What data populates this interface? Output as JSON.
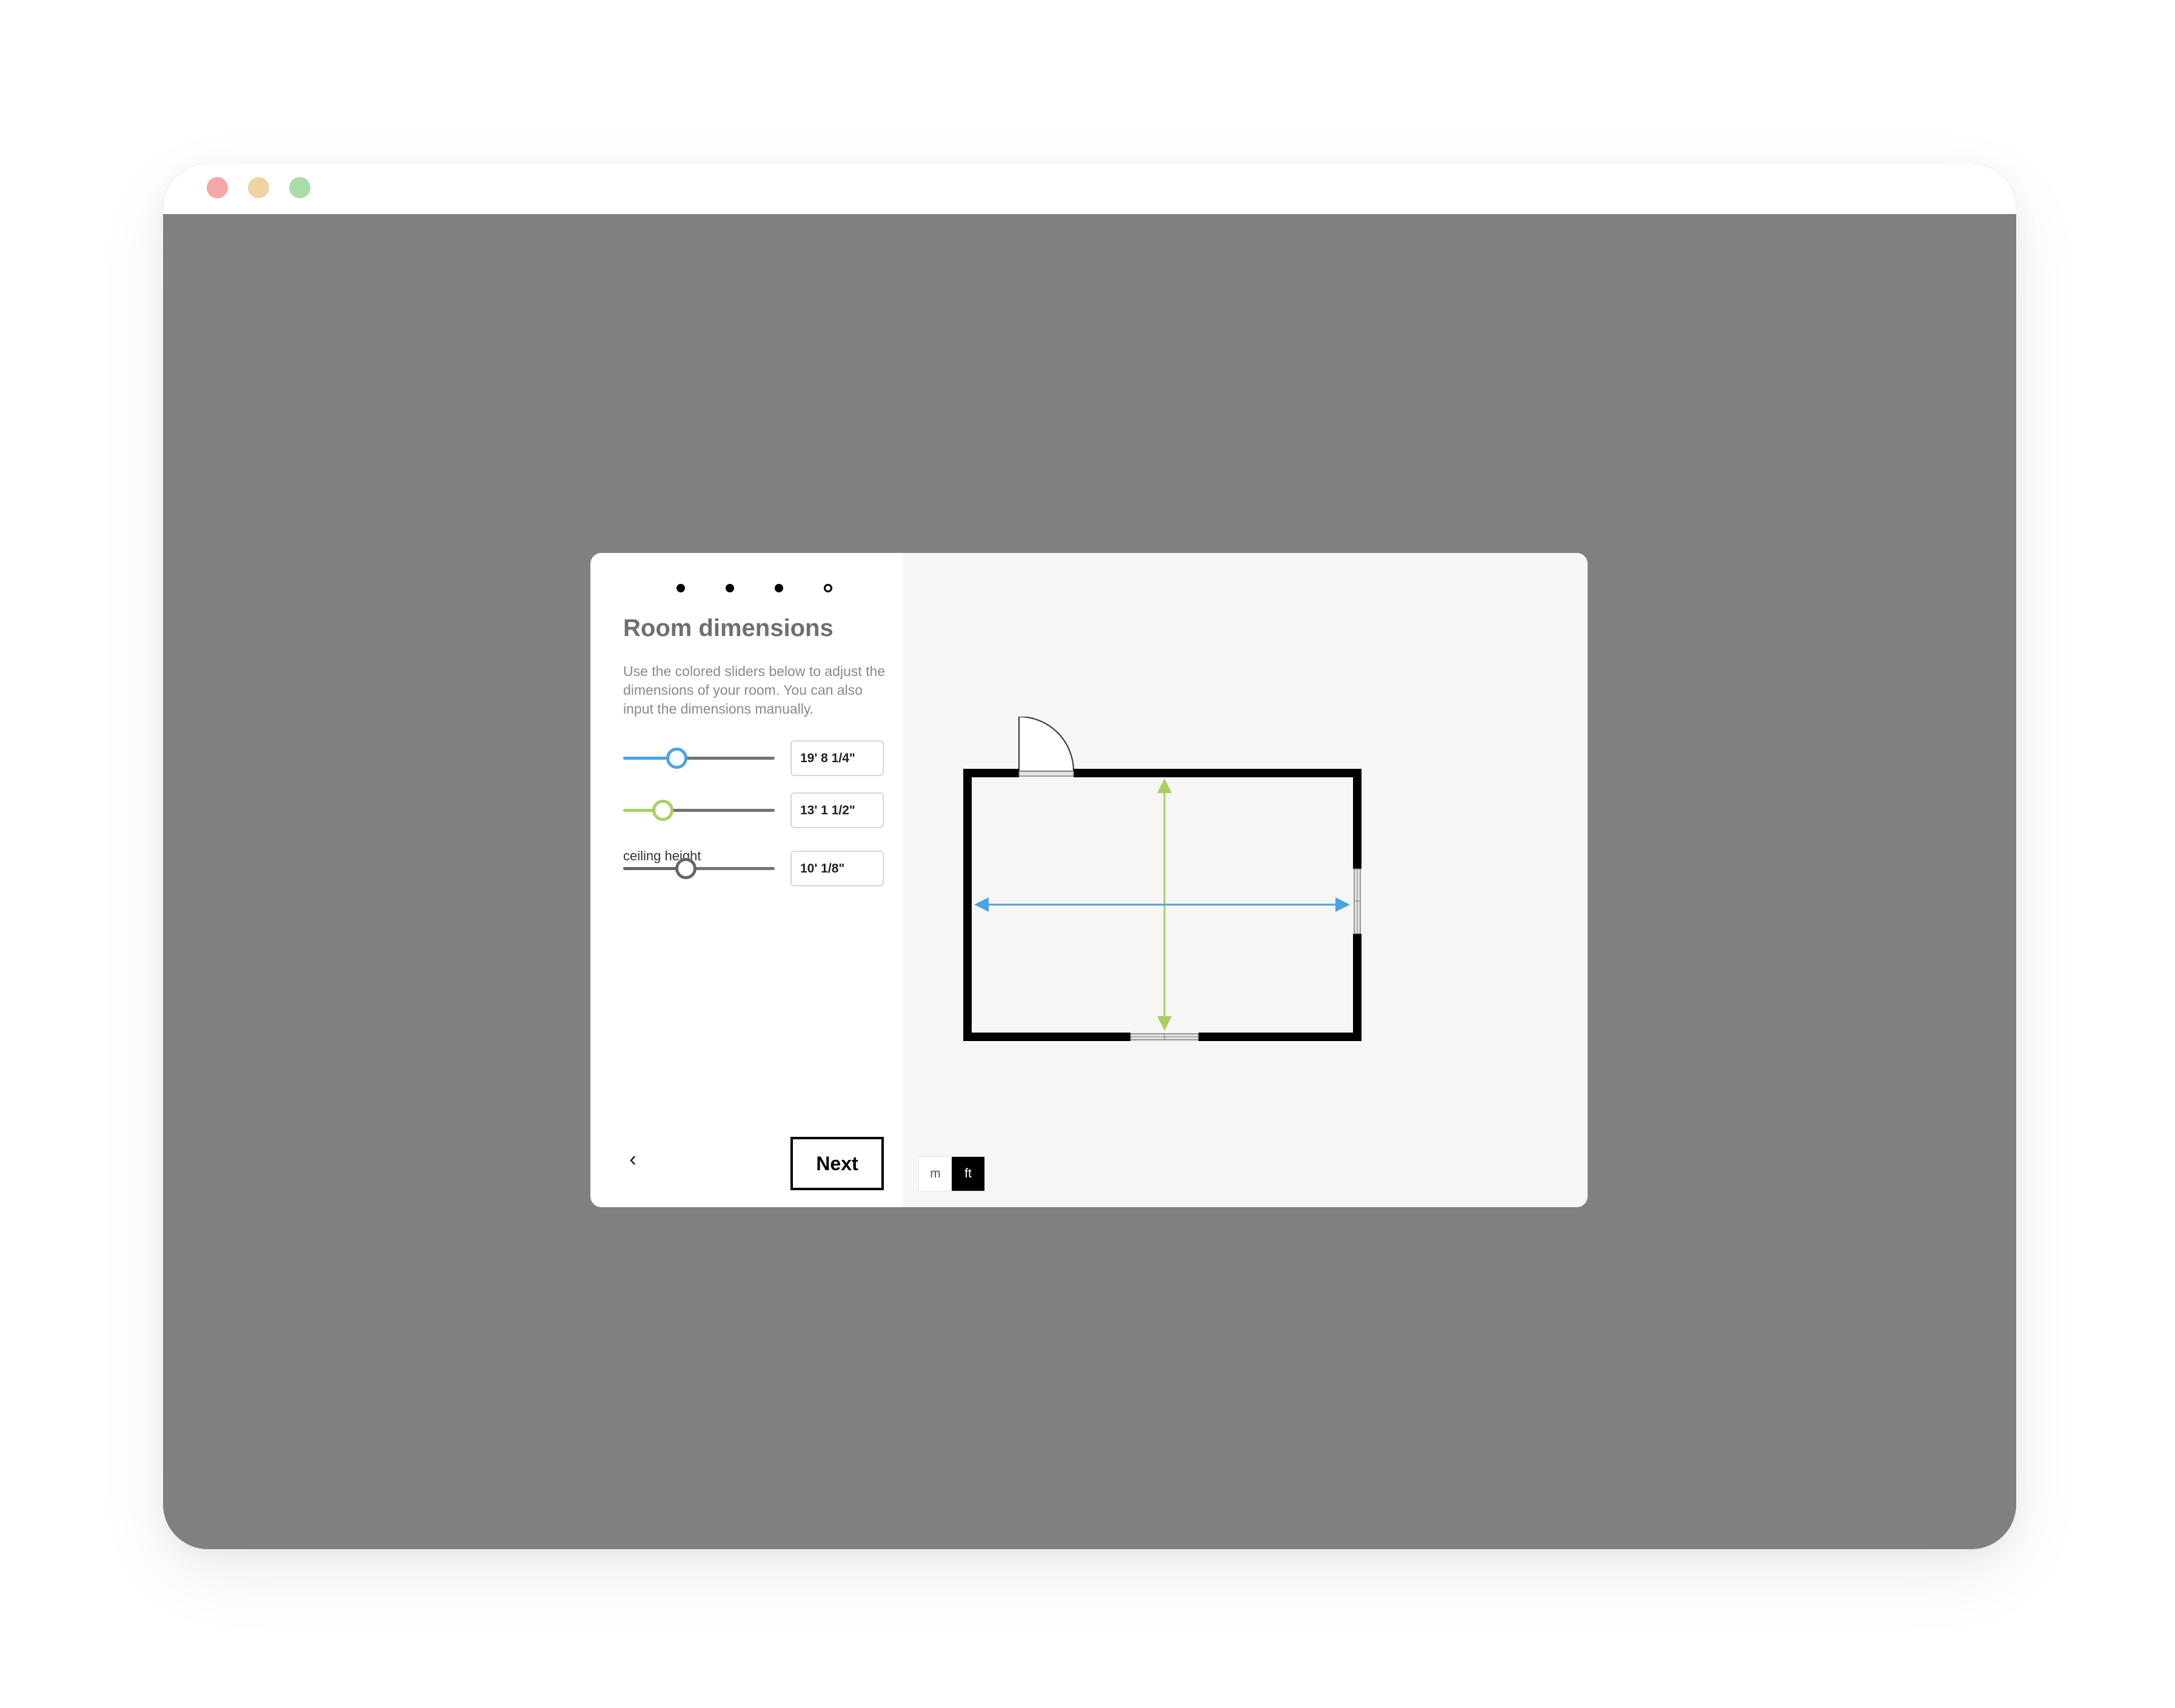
{
  "window": {
    "traffic_lights": [
      {
        "name": "close",
        "color": "#f4a7a7"
      },
      {
        "name": "minimize",
        "color": "#efd3a3"
      },
      {
        "name": "zoom",
        "color": "#a8dca8"
      }
    ]
  },
  "wizard": {
    "steps_total": 4,
    "current_step": 4
  },
  "panel": {
    "title": "Room dimensions",
    "description": "Use the colored sliders below to adjust the dimensions of your room. You can also input the dimensions manually."
  },
  "sliders": {
    "length": {
      "value": "19' 8 1/4\"",
      "color": "#4aa3e6",
      "level": 0.35
    },
    "width": {
      "value": "13' 1 1/2\"",
      "color": "#a6d160",
      "level": 0.26
    },
    "ceiling": {
      "label": "ceiling height",
      "value": "10' 1/8\"",
      "color": "#666666",
      "level": 0.41
    }
  },
  "nav": {
    "back_icon": "‹",
    "next_label": "Next"
  },
  "units": {
    "options": [
      "m",
      "ft"
    ],
    "selected": "ft"
  },
  "floorplan": {
    "length_arrow_color": "#4aa3e6",
    "width_arrow_color": "#a6d160",
    "wall_color": "#000000"
  }
}
